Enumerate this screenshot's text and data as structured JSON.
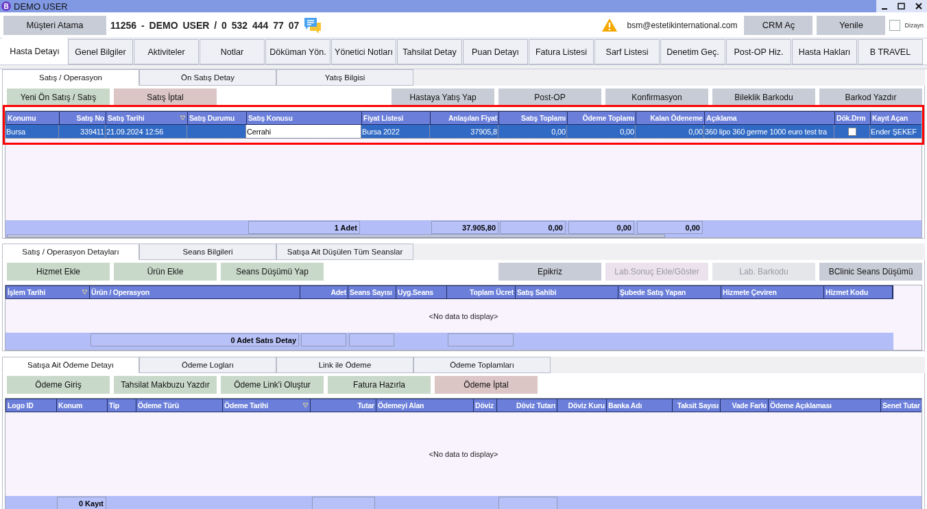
{
  "window": {
    "logo": "B",
    "title": "DEMO USER"
  },
  "header": {
    "assign_button": "Müşteri Atama",
    "patient_info": "11256 - DEMO USER / 0 532 444 77 07",
    "email": "bsm@estetikinternational.com",
    "buttons": [
      "CRM Aç",
      "Yenile"
    ],
    "design_checkbox": {
      "label": "Dizayn",
      "checked": false
    }
  },
  "main_tabs": [
    {
      "label": "Hasta Detayı",
      "selected": true
    },
    {
      "label": "Genel Bilgiler",
      "selected": false
    },
    {
      "label": "Aktiviteler",
      "selected": false
    },
    {
      "label": "Notlar",
      "selected": false
    },
    {
      "label": "Döküman Yön.",
      "selected": false
    },
    {
      "label": "Yönetici Notları",
      "selected": false
    },
    {
      "label": "Tahsilat Detay",
      "selected": false
    },
    {
      "label": "Puan Detayı",
      "selected": false
    },
    {
      "label": "Fatura Listesi",
      "selected": false
    },
    {
      "label": "Sarf Listesi",
      "selected": false
    },
    {
      "label": "Denetim Geç.",
      "selected": false
    },
    {
      "label": "Post-OP Hiz.",
      "selected": false
    },
    {
      "label": "Hasta Hakları",
      "selected": false
    },
    {
      "label": "B TRAVEL",
      "selected": false
    }
  ],
  "sections": [
    {
      "tabs": [
        {
          "label": "Satış / Operasyon",
          "selected": true
        },
        {
          "label": "Ön Satış Detay",
          "selected": false
        },
        {
          "label": "Yatış Bilgisi",
          "selected": false
        }
      ],
      "left_buttons": [
        {
          "label": "Yeni Ön Satış / Satış",
          "kind": "confirm",
          "disabled": false
        },
        {
          "label": "Satış İptal",
          "kind": "cancel",
          "disabled": false
        }
      ],
      "right_buttons": [
        {
          "label": "Hastaya Yatış Yap",
          "kind": "neutral",
          "disabled": false
        },
        {
          "label": "Post-OP",
          "kind": "neutral",
          "disabled": false
        },
        {
          "label": "Konfirmasyon",
          "kind": "neutral",
          "disabled": false
        },
        {
          "label": "Bileklik Barkodu",
          "kind": "neutral",
          "disabled": false
        },
        {
          "label": "Barkod Yazdır",
          "kind": "neutral",
          "disabled": false
        }
      ],
      "grid": {
        "highlighted": true,
        "columns": [
          {
            "label": "Konumu",
            "sorted": false
          },
          {
            "label": "Satış No",
            "sorted": false
          },
          {
            "label": "Satış Tarihi",
            "sorted": true
          },
          {
            "label": "Satış Durumu",
            "sorted": false
          },
          {
            "label": "Satış Konusu",
            "sorted": false
          },
          {
            "label": "Fiyat Listesi",
            "sorted": false
          },
          {
            "label": "Anlaşılan Fiyat",
            "sorted": false
          },
          {
            "label": "Satış Toplamı",
            "sorted": false
          },
          {
            "label": "Ödeme Toplamı",
            "sorted": false
          },
          {
            "label": "Kalan Ödeneme",
            "sorted": false
          },
          {
            "label": "Açıklama",
            "sorted": false
          },
          {
            "label": "Dök.Drm",
            "sorted": false
          },
          {
            "label": "Kayıt Açan",
            "sorted": false
          }
        ],
        "rows": [
          {
            "selected": true,
            "cells": [
              {
                "text": "Bursa",
                "focused": false
              },
              {
                "text": "339411",
                "focused": false
              },
              {
                "text": "21.09.2024 12:56",
                "focused": false
              },
              {
                "focused": false
              },
              {
                "text": "Cerrahi",
                "focused": true
              },
              {
                "text": "Bursa 2022",
                "focused": false
              },
              {
                "text": "37905,8",
                "focused": false
              },
              {
                "text": "0,00",
                "focused": false
              },
              {
                "text": "0,00",
                "focused": false
              },
              {
                "text": "0,00",
                "focused": false
              },
              {
                "text": "360 lipo 360 germe 1000 euro test tra",
                "focused": false
              },
              {
                "kind": "checkbox",
                "checked": false,
                "focused": false
              },
              {
                "text": "Ender ŞEKEF",
                "focused": false
              }
            ]
          }
        ],
        "summary": [
          "1 Adet",
          "37.905,80",
          "0,00",
          "0,00",
          "0,00"
        ]
      }
    },
    {
      "tabs": [
        {
          "label": "Satış / Operasyon Detayları",
          "selected": true
        },
        {
          "label": "Seans Bilgileri",
          "selected": false
        },
        {
          "label": "Satışa Ait Düşülen Tüm Seanslar",
          "selected": false
        }
      ],
      "left_buttons": [
        {
          "label": "Hizmet Ekle",
          "kind": "confirm",
          "disabled": false
        },
        {
          "label": "Ürün Ekle",
          "kind": "confirm",
          "disabled": false
        },
        {
          "label": "Seans Düşümü Yap",
          "kind": "confirm",
          "disabled": false
        }
      ],
      "right_buttons": [
        {
          "label": "Epikriz",
          "kind": "neutral",
          "disabled": false
        },
        {
          "label": "Lab.Sonuç Ekle/Göster",
          "kind": "cancel",
          "disabled": true
        },
        {
          "label": "Lab. Barkodu",
          "kind": "neutral",
          "disabled": true
        },
        {
          "label": "BClinic Seans Düşümü",
          "kind": "neutral",
          "disabled": false
        }
      ],
      "grid": {
        "highlighted": false,
        "columns": [
          {
            "label": "İşlem Tarihi",
            "sorted": true
          },
          {
            "label": "Ürün / Operasyon",
            "sorted": false
          },
          {
            "label": "Adet",
            "sorted": false
          },
          {
            "label": "Seans Sayısı",
            "sorted": false
          },
          {
            "label": "Uyg.Seans",
            "sorted": false
          },
          {
            "label": "Toplam Ücret",
            "sorted": false
          },
          {
            "label": "Satış Sahibi",
            "sorted": false
          },
          {
            "label": "Şubede Satış Yapan",
            "sorted": false
          },
          {
            "label": "Hizmete Çeviren",
            "sorted": false
          },
          {
            "label": "Hizmet Kodu",
            "sorted": false
          }
        ],
        "empty_text": "<No data to display>",
        "summary": [
          "0 Adet Satıs Detay"
        ]
      }
    },
    {
      "tabs": [
        {
          "label": "Satışa Ait Ödeme Detayı",
          "selected": true
        },
        {
          "label": "Ödeme Logları",
          "selected": false
        },
        {
          "label": "Link ile Ödeme",
          "selected": false
        },
        {
          "label": "Ödeme Toplamları",
          "selected": false
        }
      ],
      "left_buttons": [
        {
          "label": "Ödeme Giriş",
          "kind": "confirm",
          "disabled": false
        },
        {
          "label": "Tahsilat Makbuzu Yazdır",
          "kind": "confirm",
          "disabled": false
        },
        {
          "label": "Ödeme Link'i Oluştur",
          "kind": "confirm",
          "disabled": false
        },
        {
          "label": "Fatura Hazırla",
          "kind": "confirm",
          "disabled": false
        },
        {
          "label": "Ödeme İptal",
          "kind": "cancel",
          "disabled": false
        }
      ],
      "grid": {
        "highlighted": false,
        "columns": [
          {
            "label": "Logo ID",
            "sorted": false
          },
          {
            "label": "Konum",
            "sorted": false
          },
          {
            "label": "Tip",
            "sorted": false
          },
          {
            "label": "Ödeme Türü",
            "sorted": false
          },
          {
            "label": "Ödeme Tarihi",
            "sorted": true
          },
          {
            "label": "Tutar",
            "sorted": false
          },
          {
            "label": "Ödemeyi Alan",
            "sorted": false
          },
          {
            "label": "Döviz",
            "sorted": false
          },
          {
            "label": "Döviz Tutarı",
            "sorted": false
          },
          {
            "label": "Döviz Kuru",
            "sorted": false
          },
          {
            "label": "Banka Adı",
            "sorted": false
          },
          {
            "label": "Taksit Sayısı",
            "sorted": false
          },
          {
            "label": "Vade Farkı",
            "sorted": false
          },
          {
            "label": "Ödeme Açıklaması",
            "sorted": false
          },
          {
            "label": "Senet Tutar",
            "sorted": false
          }
        ],
        "empty_text": "<No data to display>",
        "summary": [
          "0 Kayıt"
        ]
      }
    }
  ]
}
